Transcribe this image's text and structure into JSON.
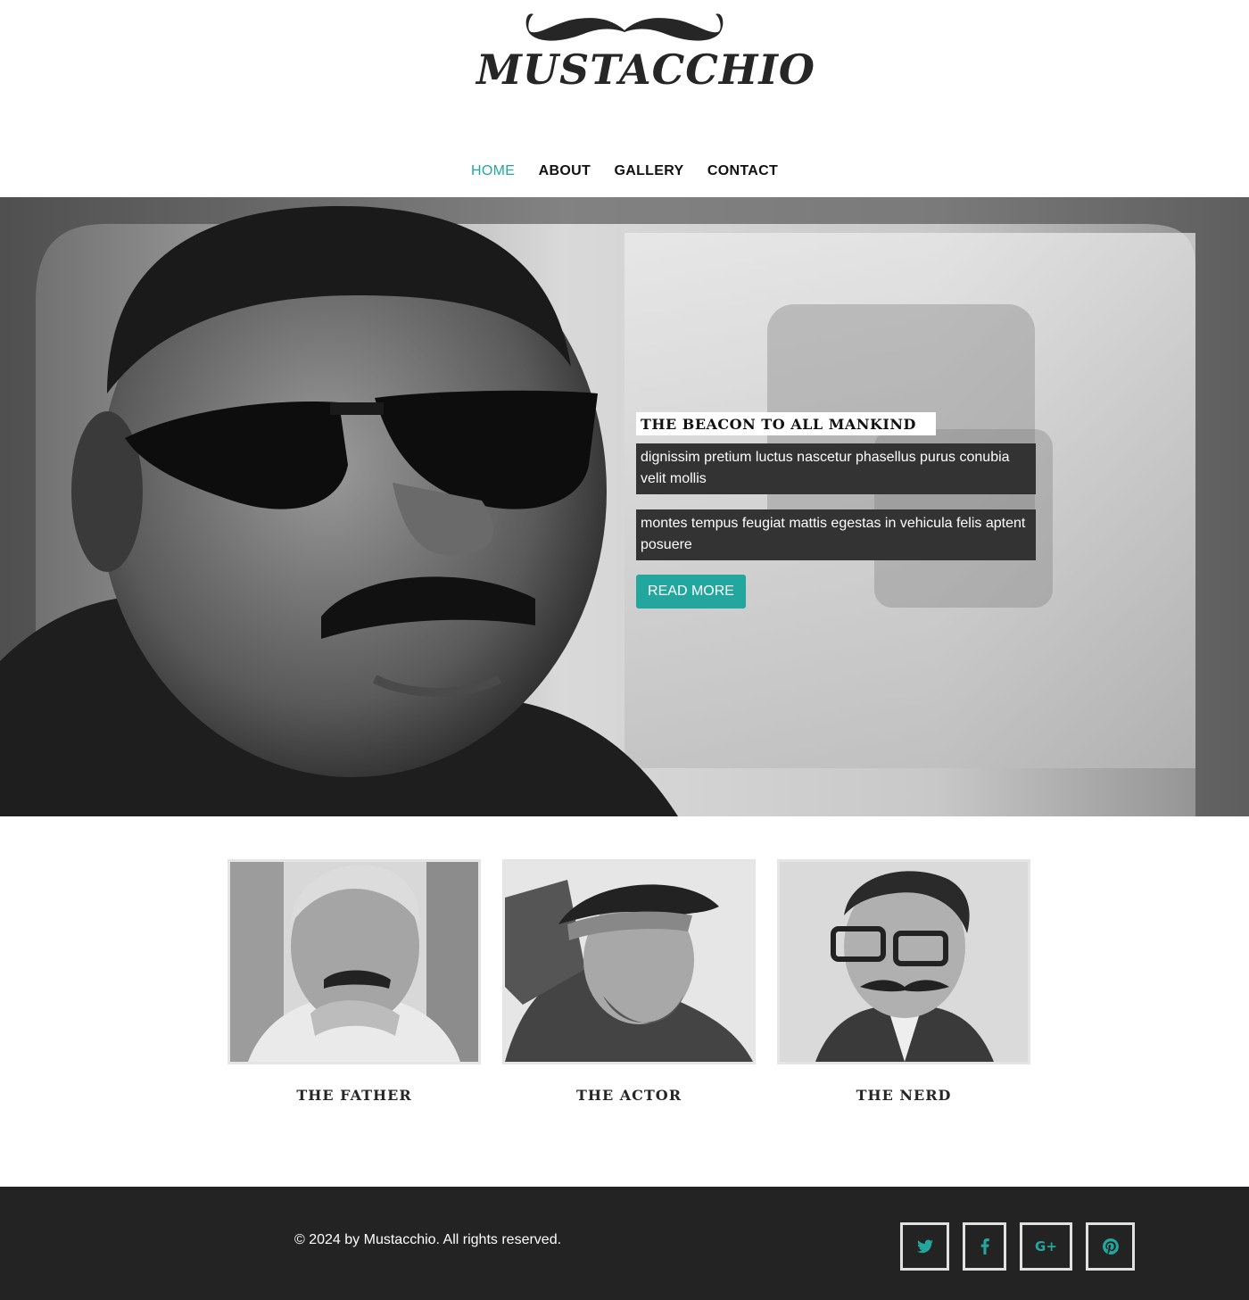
{
  "brand": {
    "logo_text": "MUSTACCHIO",
    "accent": "#22a69e"
  },
  "nav": {
    "items": [
      {
        "label": "HOME",
        "active": true
      },
      {
        "label": "ABOUT"
      },
      {
        "label": "GALLERY"
      },
      {
        "label": "CONTACT"
      }
    ]
  },
  "hero": {
    "image": "man-with-sunglasses-in-car-photo",
    "title": "THE BEACON TO ALL MANKIND",
    "paragraphs": [
      "dignissim pretium luctus nascetur phasellus purus conubia velit mollis",
      "montes tempus feugiat mattis egestas in vehicula felis aptent posuere"
    ],
    "button_label": "READ MORE"
  },
  "portraits": [
    {
      "caption": "THE FATHER",
      "image": "older-man-portrait-photo"
    },
    {
      "caption": "THE ACTOR",
      "image": "man-in-fedora-portrait-photo"
    },
    {
      "caption": "THE NERD",
      "image": "man-with-glasses-portrait-photo"
    }
  ],
  "footer": {
    "copyright": "© 2024 by Mustacchio. All rights reserved.",
    "social": [
      {
        "name": "twitter-icon",
        "glyph": "t"
      },
      {
        "name": "facebook-icon",
        "glyph": "f"
      },
      {
        "name": "google-plus-icon",
        "glyph": "G+"
      },
      {
        "name": "pinterest-icon",
        "glyph": "P"
      }
    ]
  }
}
